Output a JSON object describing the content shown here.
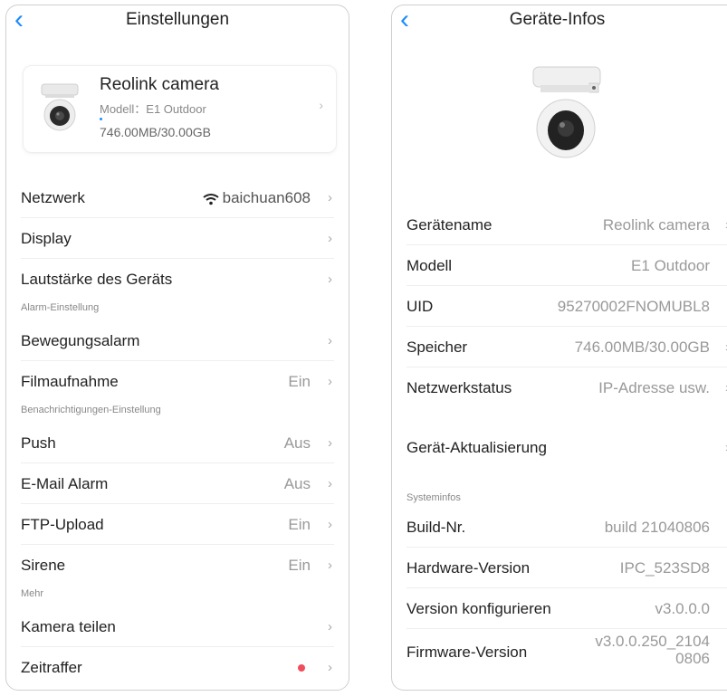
{
  "left": {
    "title": "Einstellungen",
    "device": {
      "name": "Reolink camera",
      "model": "Modell：E1 Outdoor",
      "storage": "746.00MB/30.00GB"
    },
    "rows1": [
      {
        "label": "Netzwerk",
        "value": "baichuan608",
        "icon": "wifi-icon"
      },
      {
        "label": "Display",
        "value": ""
      },
      {
        "label": "Lautstärke des Geräts",
        "value": ""
      }
    ],
    "section_alarm": "Alarm-Einstellung",
    "rows2": [
      {
        "label": "Bewegungsalarm",
        "value": ""
      },
      {
        "label": "Filmaufnahme",
        "value": "Ein"
      }
    ],
    "section_notify": "Benachrichtigungen-Einstellung",
    "rows3": [
      {
        "label": "Push",
        "value": "Aus"
      },
      {
        "label": "E-Mail Alarm",
        "value": "Aus"
      },
      {
        "label": "FTP-Upload",
        "value": "Ein"
      },
      {
        "label": "Sirene",
        "value": "Ein"
      }
    ],
    "section_more": "Mehr",
    "rows4": [
      {
        "label": "Kamera teilen",
        "value": ""
      },
      {
        "label": "Zeitraffer",
        "value": ""
      }
    ]
  },
  "right": {
    "title": "Geräte-Infos",
    "rows1": [
      {
        "label": "Gerätename",
        "value": "Reolink camera"
      },
      {
        "label": "Modell",
        "value": "E1 Outdoor"
      },
      {
        "label": "UID",
        "value": "95270002FNOMUBL8"
      },
      {
        "label": "Speicher",
        "value": "746.00MB/30.00GB"
      },
      {
        "label": "Netzwerkstatus",
        "value": "IP-Adresse usw."
      }
    ],
    "update_label": "Gerät-Aktualisierung",
    "section_system": "Systeminfos",
    "rows2": [
      {
        "label": "Build-Nr.",
        "value": "build 21040806"
      },
      {
        "label": "Hardware-Version",
        "value": "IPC_523SD8"
      },
      {
        "label": "Version konfigurieren",
        "value": "v3.0.0.0"
      },
      {
        "label": "Firmware-Version",
        "value": "v3.0.0.250_2104",
        "value2": "0806"
      }
    ]
  },
  "colors": {
    "accent": "#1a8bff",
    "alert": "#f04e5b"
  }
}
